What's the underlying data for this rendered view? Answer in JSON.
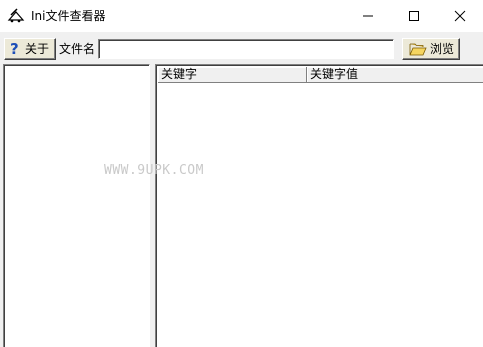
{
  "window": {
    "title": "Ini文件查看器",
    "controls": [
      "minimize",
      "maximize",
      "close"
    ]
  },
  "toolbar": {
    "about_label": "关于",
    "about_icon": "question-icon",
    "file_label": "文件名",
    "file_value": "",
    "browse_label": "浏览",
    "browse_icon": "open-folder-icon"
  },
  "table": {
    "columns": [
      "关键字",
      "关键字值"
    ],
    "rows": []
  },
  "watermark": "WWW.9UPK.COM",
  "colors": {
    "titlebar": "#ffffff",
    "background": "#f0f0f0",
    "help_icon": "#1d4fb8",
    "folder": "#e8c040"
  }
}
